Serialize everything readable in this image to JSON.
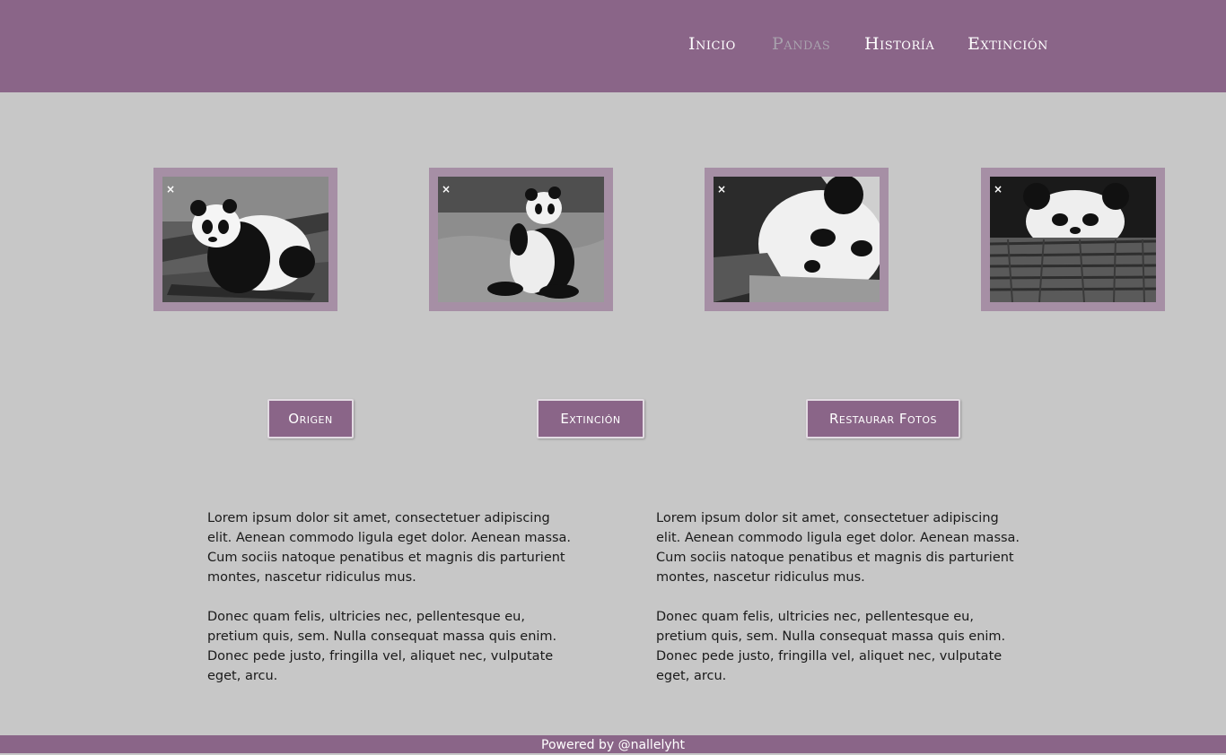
{
  "nav": {
    "items": [
      {
        "label": "Inicio",
        "active": false
      },
      {
        "label": "Pandas",
        "active": true
      },
      {
        "label": "Historía",
        "active": false
      },
      {
        "label": "Extinción",
        "active": false
      }
    ]
  },
  "gallery": {
    "close_glyph": "×",
    "photos": [
      {
        "subject": "panda resting on branch"
      },
      {
        "subject": "panda sitting on grass"
      },
      {
        "subject": "panda lying close-up"
      },
      {
        "subject": "panda peeking over log"
      }
    ]
  },
  "buttons": {
    "origen": "Origen",
    "extincion": "Extinción",
    "restaurar": "Restaurar Fotos"
  },
  "columns": [
    {
      "p1": "Lorem ipsum dolor sit amet, consectetuer adipiscing elit. Aenean commodo ligula eget dolor. Aenean massa. Cum sociis natoque penatibus et magnis dis parturient montes, nascetur ridiculus mus.",
      "p2": "Donec quam felis, ultricies nec, pellentesque eu, pretium quis, sem. Nulla consequat massa quis enim. Donec pede justo, fringilla vel, aliquet nec, vulputate eget, arcu."
    },
    {
      "p1": "Lorem ipsum dolor sit amet, consectetuer adipiscing elit. Aenean commodo ligula eget dolor. Aenean massa. Cum sociis natoque penatibus et magnis dis parturient montes, nascetur ridiculus mus.",
      "p2": "Donec quam felis, ultricies nec, pellentesque eu, pretium quis, sem. Nulla consequat massa quis enim. Donec pede justo, fringilla vel, aliquet nec, vulputate eget, arcu."
    }
  ],
  "footer": {
    "text": "Powered by @nallelyht"
  },
  "colors": {
    "header": "#8a6588",
    "background": "#c7c7c7",
    "frame": "#a68fa5",
    "nav_active": "#a8a1ad"
  }
}
